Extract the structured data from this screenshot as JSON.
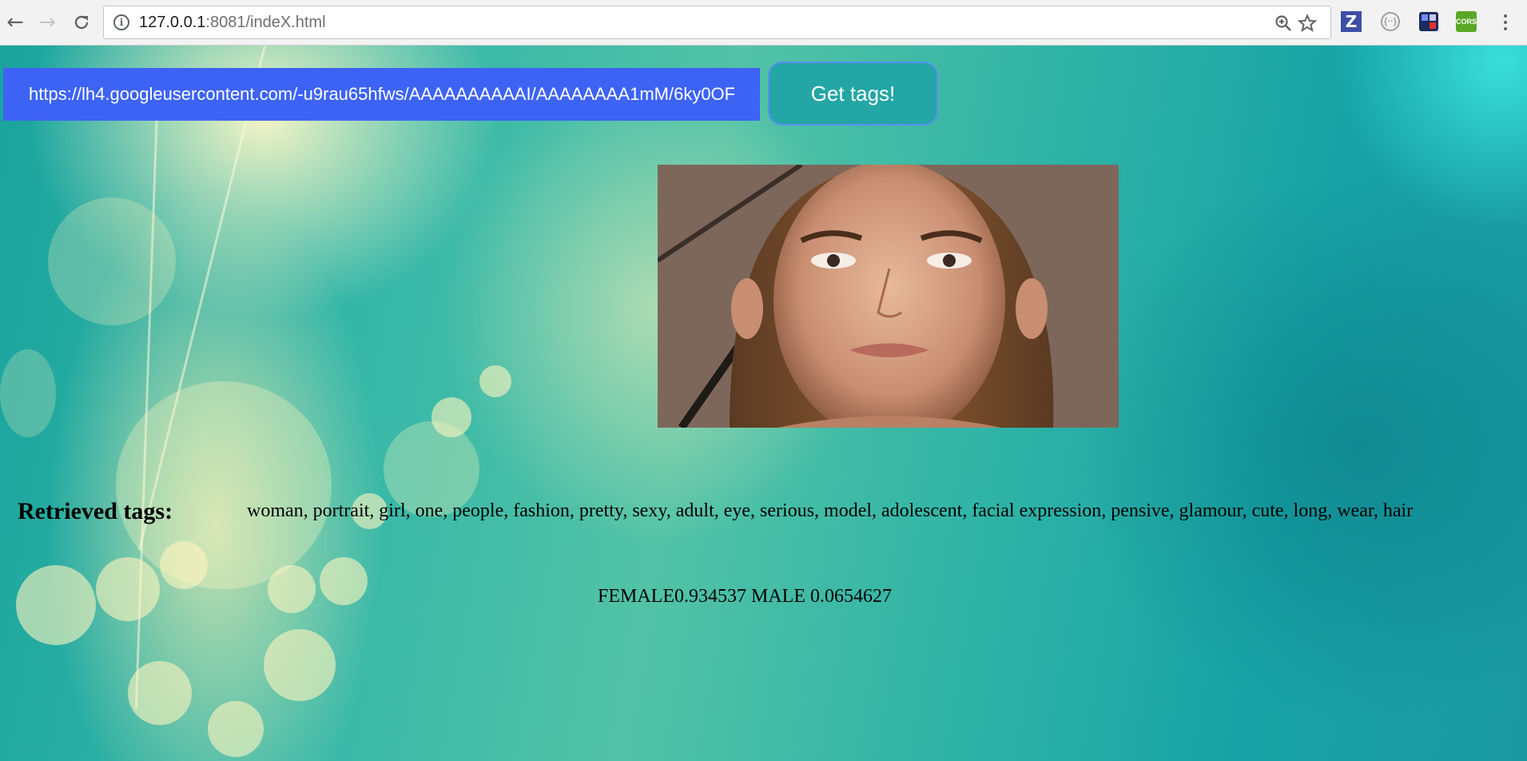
{
  "browser": {
    "url_host": "127.0.0.1",
    "url_rest": ":8081/indeX.html",
    "extensions": {
      "zotero_label": "Z",
      "bracket_label": "{··}",
      "cors_label": "CORS"
    }
  },
  "form": {
    "url_value": "https://lh4.googleusercontent.com/-u9rau65hfws/AAAAAAAAAAI/AAAAAAAA1mM/6ky0OF",
    "submit_label": "Get tags!"
  },
  "results": {
    "heading": "Retrieved tags:",
    "tags": "woman, portrait, girl, one, people, fashion, pretty, sexy, adult, eye, serious, model, adolescent, facial expression, pensive, glamour, cute, long, wear, hair",
    "gender": "FEMALE0.934537 MALE 0.0654627"
  },
  "colors": {
    "input_bg": "#3d63f5",
    "button_bg": "#23a6a5",
    "button_border": "#5b8ef2"
  }
}
